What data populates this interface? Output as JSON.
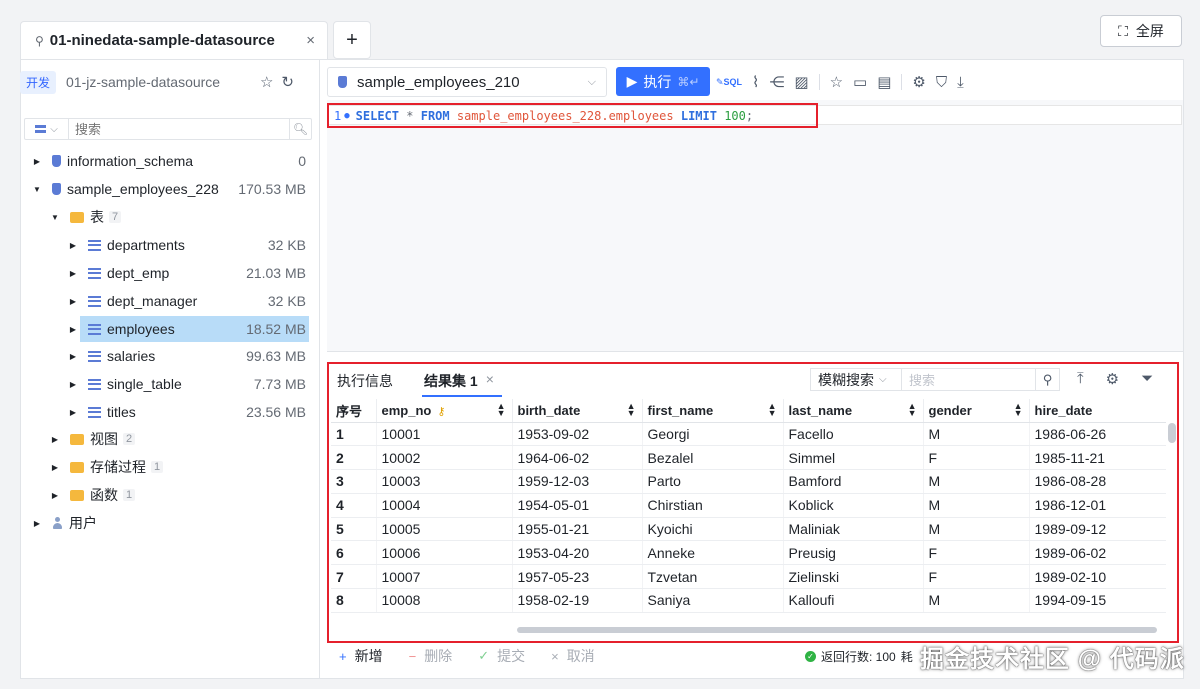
{
  "tabs": {
    "active_title": "01-ninedata-sample-datasource",
    "add_label": "+",
    "close_label": "×"
  },
  "fullscreen_label": "全屏",
  "env": {
    "badge": "开发",
    "name": "01-jz-sample-datasource"
  },
  "tree": {
    "search_placeholder": "搜索",
    "items": [
      {
        "label": "information_schema",
        "size": "0"
      },
      {
        "label": "sample_employees_228",
        "size": "170.53 MB"
      },
      {
        "label": "表",
        "count": "7"
      },
      {
        "label": "departments",
        "size": "32 KB"
      },
      {
        "label": "dept_emp",
        "size": "21.03 MB"
      },
      {
        "label": "dept_manager",
        "size": "32 KB"
      },
      {
        "label": "employees",
        "size": "18.52 MB"
      },
      {
        "label": "salaries",
        "size": "99.63 MB"
      },
      {
        "label": "single_table",
        "size": "7.73 MB"
      },
      {
        "label": "titles",
        "size": "23.56 MB"
      },
      {
        "label": "视图",
        "count": "2"
      },
      {
        "label": "存储过程",
        "count": "1"
      },
      {
        "label": "函数",
        "count": "1"
      },
      {
        "label": "用户"
      }
    ]
  },
  "editor": {
    "database": "sample_employees_210",
    "run_label": "执行",
    "run_shortcut": "⌘↵",
    "line_number": "1",
    "sql": {
      "kw1": "SELECT",
      "star": "*",
      "kw2": "FROM",
      "table": "sample_employees_228.employees",
      "kw3": "LIMIT",
      "limit": "100",
      "end": ";"
    }
  },
  "results": {
    "tab_info": "执行信息",
    "tab_set": "结果集 1",
    "fuzzy_label": "模糊搜索",
    "search_placeholder": "搜索",
    "columns": [
      "序号",
      "emp_no",
      "birth_date",
      "first_name",
      "last_name",
      "gender",
      "hire_date"
    ],
    "rows": [
      [
        "1",
        "10001",
        "1953-09-02",
        "Georgi",
        "Facello",
        "M",
        "1986-06-26"
      ],
      [
        "2",
        "10002",
        "1964-06-02",
        "Bezalel",
        "Simmel",
        "F",
        "1985-11-21"
      ],
      [
        "3",
        "10003",
        "1959-12-03",
        "Parto",
        "Bamford",
        "M",
        "1986-08-28"
      ],
      [
        "4",
        "10004",
        "1954-05-01",
        "Chirstian",
        "Koblick",
        "M",
        "1986-12-01"
      ],
      [
        "5",
        "10005",
        "1955-01-21",
        "Kyoichi",
        "Maliniak",
        "M",
        "1989-09-12"
      ],
      [
        "6",
        "10006",
        "1953-04-20",
        "Anneke",
        "Preusig",
        "F",
        "1989-06-02"
      ],
      [
        "7",
        "10007",
        "1957-05-23",
        "Tzvetan",
        "Zielinski",
        "F",
        "1989-02-10"
      ],
      [
        "8",
        "10008",
        "1958-02-19",
        "Saniya",
        "Kalloufi",
        "M",
        "1994-09-15"
      ]
    ]
  },
  "bottom": {
    "add": "新增",
    "delete": "删除",
    "commit": "提交",
    "cancel": "取消",
    "rows_label": "返回行数: 100",
    "trailing": "耗"
  },
  "watermark": "掘金技术社区 @ 代码派"
}
